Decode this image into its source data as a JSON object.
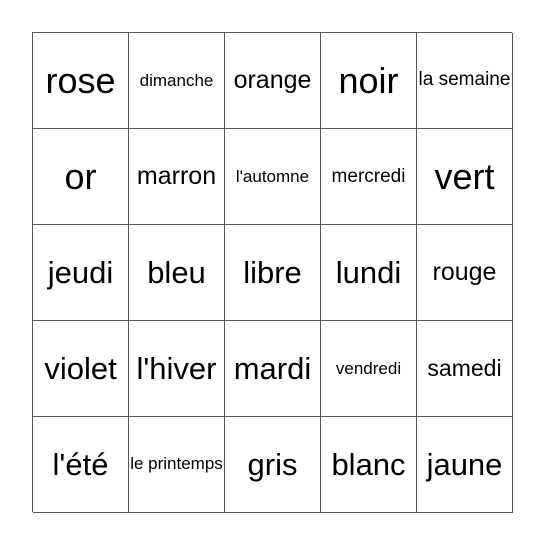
{
  "card": {
    "rows": [
      [
        "rose",
        "dimanche",
        "orange",
        "noir",
        "la semaine"
      ],
      [
        "or",
        "marron",
        "l'automne",
        "mercredi",
        "vert"
      ],
      [
        "jeudi",
        "bleu",
        "libre",
        "lundi",
        "rouge"
      ],
      [
        "violet",
        "l'hiver",
        "mardi",
        "vendredi",
        "samedi"
      ],
      [
        "l'été",
        "le printemps",
        "gris",
        "blanc",
        "jaune"
      ]
    ]
  }
}
